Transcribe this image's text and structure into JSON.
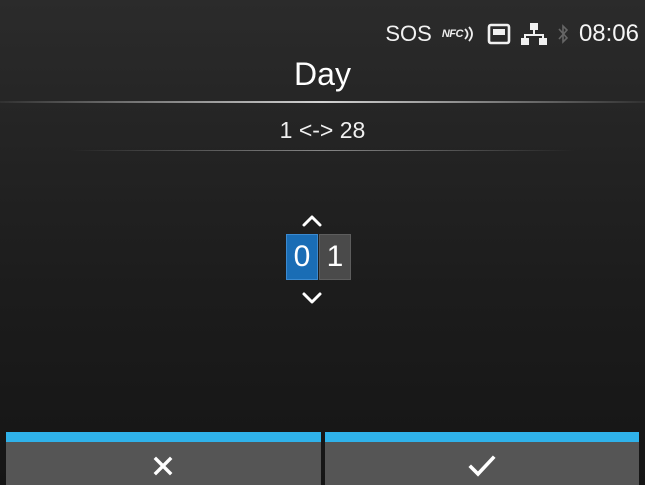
{
  "status": {
    "sos_label": "SOS",
    "nfc_label": "NFC",
    "time": "08:06",
    "icons": [
      "nfc-icon",
      "sd-card-icon",
      "network-icon",
      "bluetooth-icon"
    ]
  },
  "header": {
    "title": "Day"
  },
  "range_label": "1 <-> 28",
  "spinner": {
    "digits": [
      "0",
      "1"
    ],
    "active_index": 0
  },
  "footer": {
    "cancel_icon": "close-icon",
    "confirm_icon": "check-icon"
  },
  "colors": {
    "accent": "#2fb2ea",
    "active_digit": "#1a6db5",
    "footer_button": "#555555"
  }
}
